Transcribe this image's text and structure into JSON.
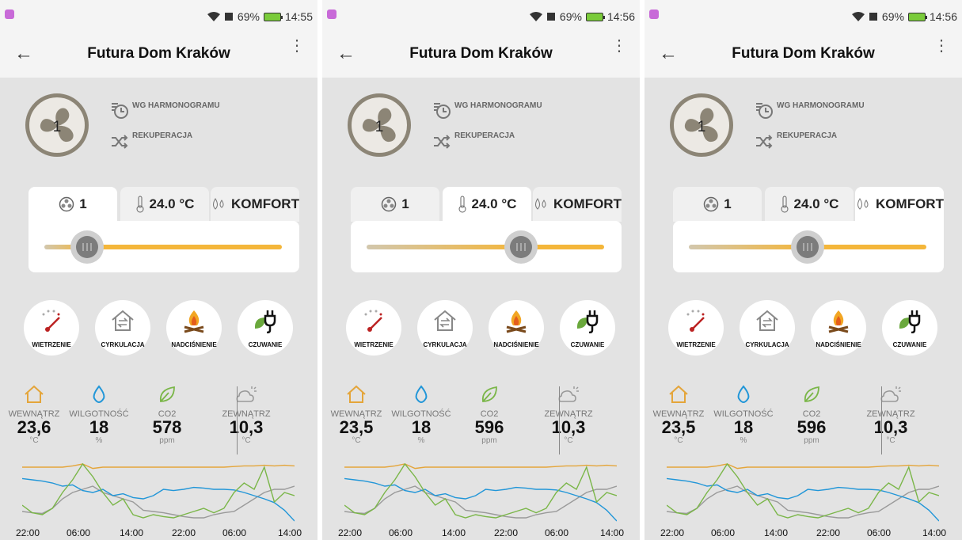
{
  "screens": [
    {
      "status": {
        "battery": "69%",
        "time": "14:55"
      },
      "title": "Futura Dom Kraków",
      "fan_level": "1",
      "modes": [
        "WG HARMONOGRAMU",
        "REKUPERACJA"
      ],
      "tabs": [
        "1",
        "24.0 °C",
        "KOMFORT"
      ],
      "active_tab": 0,
      "slider_value": 0.18,
      "buttons": [
        "WIETRZENIE",
        "CYRKULACJA",
        "NADCIŚNIENIE",
        "CZUWANIE"
      ],
      "metrics": [
        {
          "name": "WEWNĄTRZ",
          "value": "23,6",
          "unit": "°C"
        },
        {
          "name": "WILGOTNOŚĆ",
          "value": "18",
          "unit": "%"
        },
        {
          "name": "CO2",
          "value": "578",
          "unit": "ppm"
        },
        {
          "name": "ZEWNĄTRZ",
          "value": "10,3",
          "unit": "°C"
        }
      ],
      "time_labels": [
        "22:00",
        "06:00",
        "14:00",
        "22:00",
        "06:00",
        "14:00"
      ]
    },
    {
      "status": {
        "battery": "69%",
        "time": "14:56"
      },
      "title": "Futura Dom Kraków",
      "fan_level": "1",
      "modes": [
        "WG HARMONOGRAMU",
        "REKUPERACJA"
      ],
      "tabs": [
        "1",
        "24.0 °C",
        "KOMFORT"
      ],
      "active_tab": 1,
      "slider_value": 0.65,
      "buttons": [
        "WIETRZENIE",
        "CYRKULACJA",
        "NADCIŚNIENIE",
        "CZUWANIE"
      ],
      "metrics": [
        {
          "name": "WEWNĄTRZ",
          "value": "23,5",
          "unit": "°C"
        },
        {
          "name": "WILGOTNOŚĆ",
          "value": "18",
          "unit": "%"
        },
        {
          "name": "CO2",
          "value": "596",
          "unit": "ppm"
        },
        {
          "name": "ZEWNĄTRZ",
          "value": "10,3",
          "unit": "°C"
        }
      ],
      "time_labels": [
        "22:00",
        "06:00",
        "14:00",
        "22:00",
        "06:00",
        "14:00"
      ]
    },
    {
      "status": {
        "battery": "69%",
        "time": "14:56"
      },
      "title": "Futura Dom Kraków",
      "fan_level": "1",
      "modes": [
        "WG HARMONOGRAMU",
        "REKUPERACJA"
      ],
      "tabs": [
        "1",
        "24.0 °C",
        "KOMFORT"
      ],
      "active_tab": 2,
      "slider_value": 0.5,
      "buttons": [
        "WIETRZENIE",
        "CYRKULACJA",
        "NADCIŚNIENIE",
        "CZUWANIE"
      ],
      "metrics": [
        {
          "name": "WEWNĄTRZ",
          "value": "23,5",
          "unit": "°C"
        },
        {
          "name": "WILGOTNOŚĆ",
          "value": "18",
          "unit": "%"
        },
        {
          "name": "CO2",
          "value": "596",
          "unit": "ppm"
        },
        {
          "name": "ZEWNĄTRZ",
          "value": "10,3",
          "unit": "°C"
        }
      ],
      "time_labels": [
        "22:00",
        "06:00",
        "14:00",
        "22:00",
        "06:00",
        "14:00"
      ]
    }
  ],
  "icons": {
    "fan": "fan-icon",
    "schedule": "schedule-clock-icon",
    "recuperation": "shuffle-arrows-icon",
    "fan_tab": "fan-small-icon",
    "temp_tab": "thermometer-icon",
    "comfort_tab": "drops-icon",
    "buttons": [
      "gauge-icon",
      "house-circulation-icon",
      "fire-icon",
      "plug-leaf-icon"
    ],
    "metrics": [
      "house-icon",
      "water-drop-icon",
      "leaf-icon",
      "sun-cloud-icon"
    ]
  },
  "colors": {
    "inside": "#e4a53a",
    "humidity": "#2196d8",
    "co2": "#7ab648",
    "outside": "#9a9a9a",
    "accent": "#f4b63a"
  }
}
